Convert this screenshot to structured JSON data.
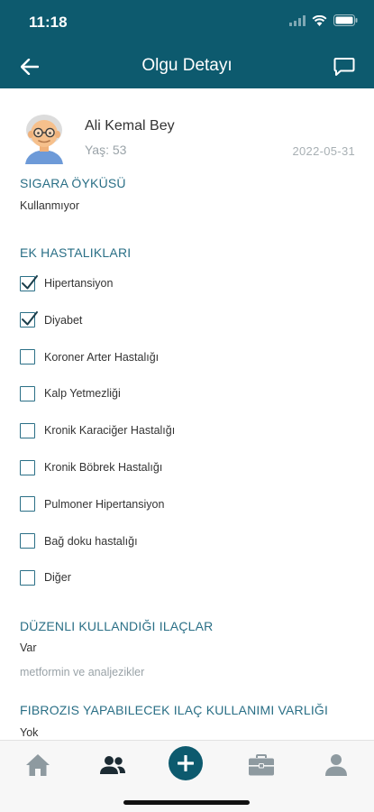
{
  "status_bar": {
    "time": "11:18"
  },
  "header": {
    "title": "Olgu Detayı"
  },
  "patient": {
    "name": "Ali Kemal Bey",
    "age": "Yaş: 53",
    "date": "2022-05-31"
  },
  "smoking": {
    "title": "SIGARA ÖYKÜSÜ",
    "value": "Kullanmıyor"
  },
  "comorbidities": {
    "title": "EK HASTALIKLARI",
    "items": [
      {
        "label": "Hipertansiyon",
        "checked": true
      },
      {
        "label": "Diyabet",
        "checked": true
      },
      {
        "label": "Koroner Arter Hastalığı",
        "checked": false
      },
      {
        "label": "Kalp Yetmezliği",
        "checked": false
      },
      {
        "label": "Kronik Karaciğer Hastalığı",
        "checked": false
      },
      {
        "label": "Kronik Böbrek Hastalığı",
        "checked": false
      },
      {
        "label": "Pulmoner Hipertansiyon",
        "checked": false
      },
      {
        "label": "Bağ doku hastalığı",
        "checked": false
      },
      {
        "label": "Diğer",
        "checked": false
      }
    ]
  },
  "medications": {
    "title": "DÜZENLI KULLANDIĞI ILAÇLAR",
    "value": "Var",
    "detail": "metformin ve analjezikler"
  },
  "fibrosis": {
    "title": "FIBROZIS YAPABILECEK ILAÇ KULLANIMI VARLIĞI",
    "value": "Yok"
  },
  "tab_bar": {
    "items": [
      {
        "name": "home-icon"
      },
      {
        "name": "people-icon"
      },
      {
        "name": "add-icon"
      },
      {
        "name": "briefcase-icon"
      },
      {
        "name": "person-icon"
      }
    ]
  },
  "colors": {
    "primary": "#0d5a6e",
    "section": "#2a6f86",
    "muted": "#9aa3a8",
    "tab_icon": "#8e9aa0"
  }
}
